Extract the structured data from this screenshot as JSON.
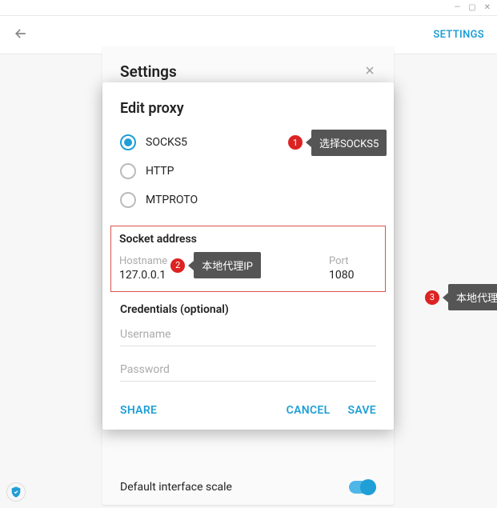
{
  "titlebar": {
    "min": "—",
    "max": "▢",
    "close": "✕"
  },
  "topbar": {
    "settings": "SETTINGS"
  },
  "settingsCard": {
    "title": "Settings",
    "scaleLabel": "Default interface scale"
  },
  "dialog": {
    "title": "Edit proxy",
    "radios": {
      "socks5": "SOCKS5",
      "http": "HTTP",
      "mtproto": "MTPROTO"
    },
    "socketTitle": "Socket address",
    "hostnameLabel": "Hostname",
    "hostnameValue": "127.0.0.1",
    "portLabel": "Port",
    "portValue": "1080",
    "credsTitle": "Credentials (optional)",
    "usernamePH": "Username",
    "passwordPH": "Password",
    "share": "SHARE",
    "cancel": "CANCEL",
    "save": "SAVE"
  },
  "callouts": {
    "n1": "1",
    "t1": "选择SOCKS5",
    "n2": "2",
    "t2": "本地代理IP",
    "n3": "3",
    "t3": "本地代理默认端口"
  }
}
